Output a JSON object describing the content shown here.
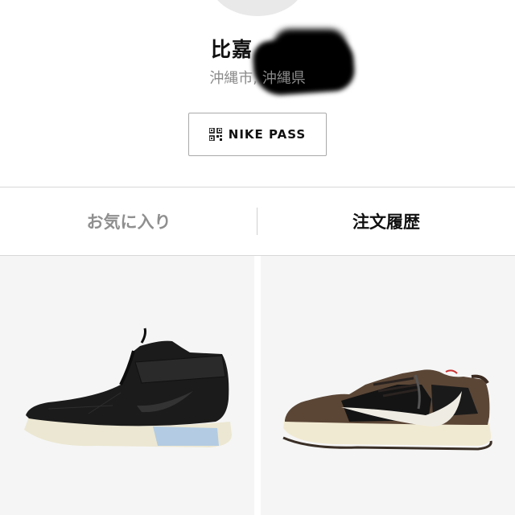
{
  "profile": {
    "name": "比嘉",
    "location": "沖縄市, 沖縄県"
  },
  "nike_pass": {
    "label": "NIKE PASS",
    "icon": "qr-code-icon"
  },
  "tabs": [
    {
      "label": "お気に入り",
      "active": false
    },
    {
      "label": "注文履歴",
      "active": true
    }
  ],
  "products": [
    {
      "description_icon": "black-high-top-sneaker-image"
    },
    {
      "description_icon": "brown-black-low-top-sneaker-image"
    }
  ],
  "colors": {
    "inactive_tab": "#8f8f8f",
    "active_tab": "#111111",
    "tile_background": "#f5f5f5"
  }
}
